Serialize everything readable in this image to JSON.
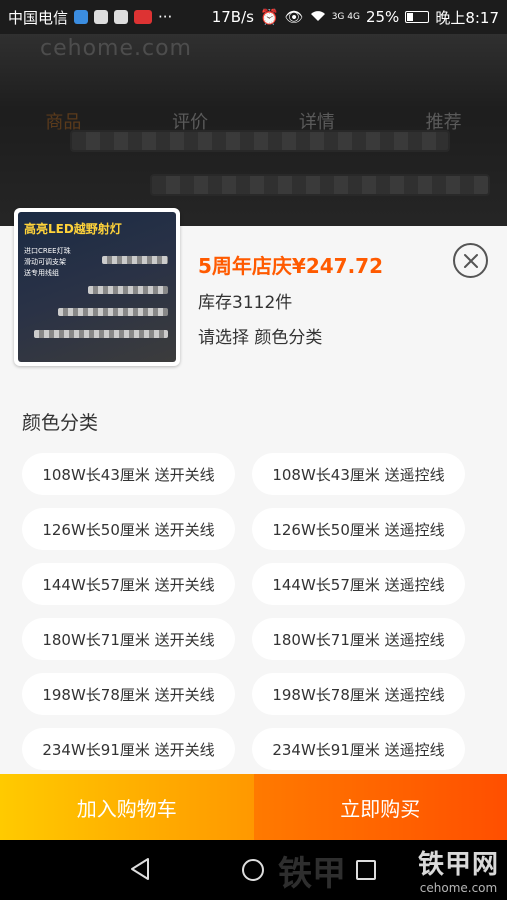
{
  "status_bar": {
    "carrier": "中国电信",
    "more": "···",
    "speed": "17B/s",
    "signal": "3G 4G",
    "battery": "25%",
    "time": "晚上8:17",
    "battery_level": 0.25
  },
  "background": {
    "logo_text": "cehome.com",
    "tabs": [
      "商品",
      "评价",
      "详情",
      "推荐"
    ]
  },
  "product": {
    "image_title": "高亮LED越野射灯",
    "image_bullets": [
      "进口CREE灯珠",
      "滑动可调支架",
      "送专用线组"
    ],
    "price": "5周年店庆¥247.72",
    "stock": "库存3112件",
    "select_hint": "请选择 颜色分类"
  },
  "variants": {
    "title": "颜色分类",
    "options": [
      "108W长43厘米 送开关线",
      "108W长43厘米 送遥控线",
      "126W长50厘米 送开关线",
      "126W长50厘米 送遥控线",
      "144W长57厘米 送开关线",
      "144W长57厘米 送遥控线",
      "180W长71厘米 送开关线",
      "180W长71厘米 送遥控线",
      "198W长78厘米 送开关线",
      "198W长78厘米 送遥控线",
      "234W长91厘米 送开关线",
      "234W长91厘米 送遥控线"
    ]
  },
  "actions": {
    "add_to_cart": "加入购物车",
    "buy_now": "立即购买"
  },
  "watermark": {
    "cn": "铁甲网",
    "en": "cehome.com",
    "ghost": "铁甲"
  },
  "colors": {
    "accent_price": "#ff5a00",
    "cart_button": "#ffb000",
    "buy_button": "#ff6a00"
  }
}
